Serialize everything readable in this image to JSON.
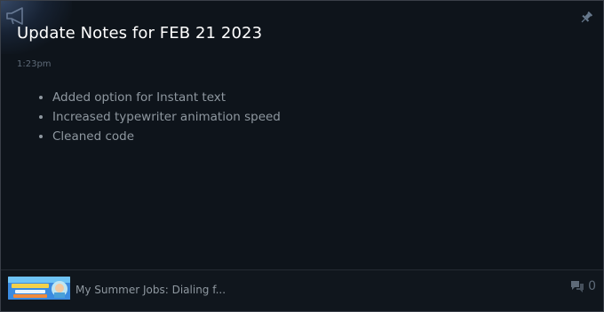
{
  "post": {
    "title": "Update Notes for FEB 21 2023",
    "time": "1:23pm",
    "notes": [
      "Added option for Instant text",
      "Increased typewriter animation speed",
      "Cleaned code"
    ]
  },
  "footer": {
    "game_name": "My Summer Jobs: Dialing f...",
    "comment_count": "0"
  },
  "icons": {
    "announcement": "megaphone-icon",
    "pin": "pin-icon",
    "comments": "comment-bubble-icon"
  },
  "colors": {
    "background": "#0e141b",
    "title": "#ffffff",
    "body_text": "#8f98a0",
    "muted": "#5e6a78"
  }
}
